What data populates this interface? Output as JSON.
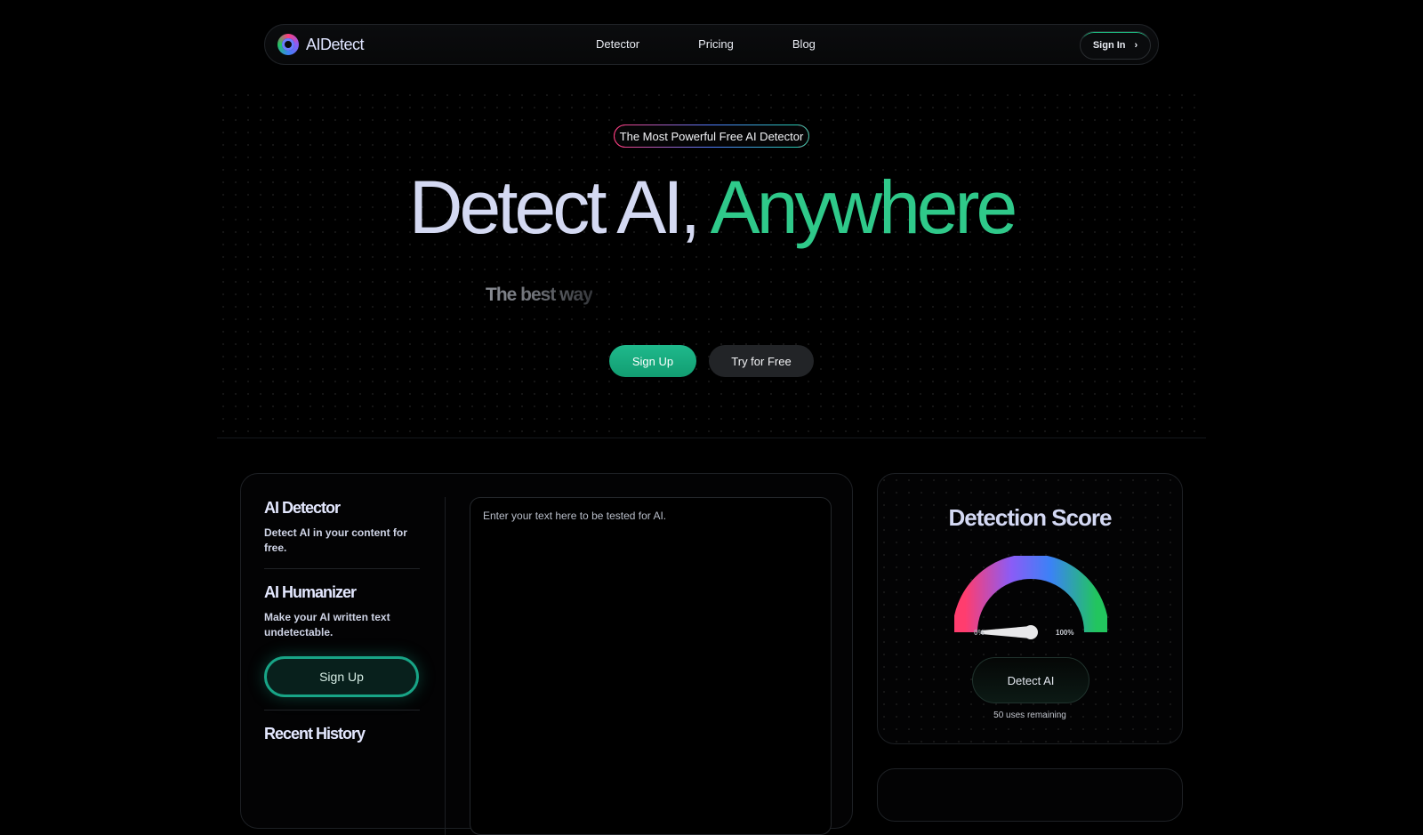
{
  "brand": {
    "name": "AIDetect"
  },
  "nav": {
    "links": [
      "Detector",
      "Pricing",
      "Blog"
    ],
    "signin_label": "Sign In",
    "signin_chevron": "›"
  },
  "hero": {
    "badge": "The Most Powerful Free AI Detector",
    "headline_part1": "Detect AI,",
    "headline_part2": "Anywhere",
    "typing_text": "The best way",
    "signup_label": "Sign Up",
    "try_label": "Try for Free"
  },
  "sidebar": {
    "detector_title": "AI Detector",
    "detector_desc": "Detect AI in your content for free.",
    "humanizer_title": "AI Humanizer",
    "humanizer_desc": "Make your AI written text undetectable.",
    "signup_label": "Sign Up",
    "history_title": "Recent History"
  },
  "editor": {
    "placeholder": "Enter your text here to be tested for AI."
  },
  "score": {
    "title": "Detection Score",
    "label_min": "0%",
    "label_max": "100%",
    "value_percent": 0,
    "detect_label": "Detect AI",
    "uses_remaining": "50 uses remaining",
    "gauge_colors": [
      "#ff3d6e",
      "#8b5cf6",
      "#3b82f6",
      "#22c55e"
    ]
  },
  "icons": [
    "logo-icon",
    "chevron-right-icon"
  ]
}
